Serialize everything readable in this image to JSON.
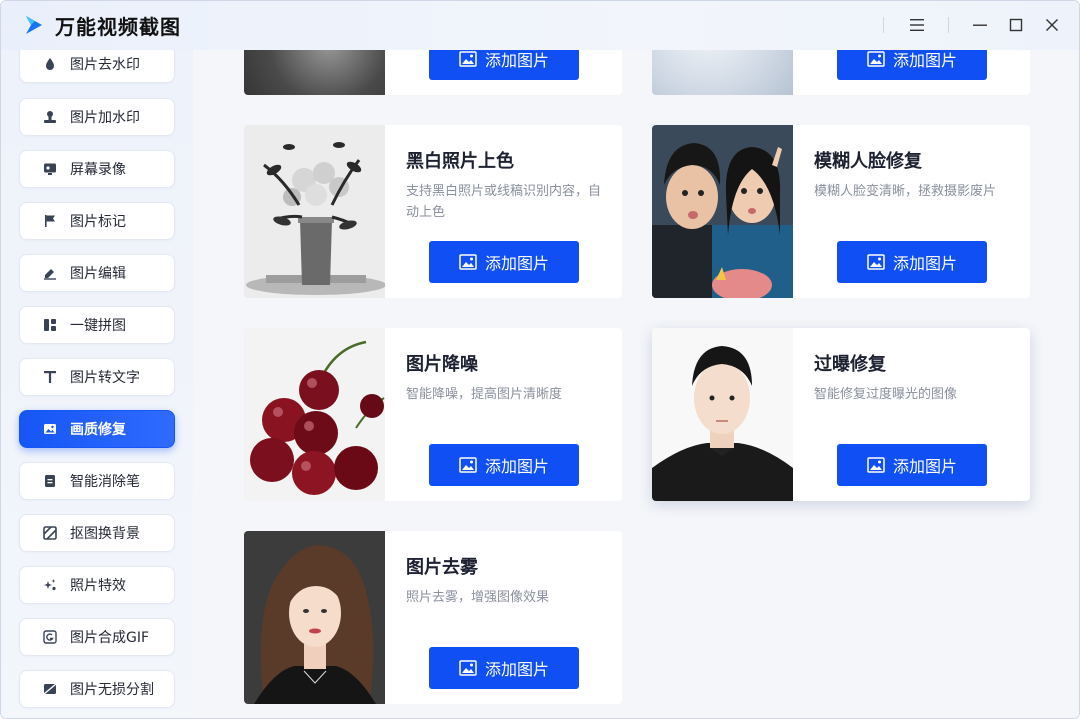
{
  "app": {
    "title": "万能视频截图"
  },
  "window_controls": {
    "menu_icon": "menu-icon",
    "minimize_icon": "minimize-icon",
    "maximize_icon": "maximize-icon",
    "close_icon": "close-icon"
  },
  "colors": {
    "accent": "#0f4ff3",
    "active_item": "#1656f5"
  },
  "sidebar": {
    "items": [
      {
        "label": "图片去水印",
        "icon": "drop-icon",
        "active": false
      },
      {
        "label": "图片加水印",
        "icon": "stamp-icon",
        "active": false
      },
      {
        "label": "屏幕录像",
        "icon": "screen-record-icon",
        "active": false
      },
      {
        "label": "图片标记",
        "icon": "flag-icon",
        "active": false
      },
      {
        "label": "图片编辑",
        "icon": "edit-icon",
        "active": false
      },
      {
        "label": "一键拼图",
        "icon": "grid-icon",
        "active": false
      },
      {
        "label": "图片转文字",
        "icon": "text-icon",
        "active": false
      },
      {
        "label": "画质修复",
        "icon": "image-icon",
        "active": true
      },
      {
        "label": "智能消除笔",
        "icon": "eraser-icon",
        "active": false
      },
      {
        "label": "抠图换背景",
        "icon": "cutout-icon",
        "active": false
      },
      {
        "label": "照片特效",
        "icon": "sparkle-icon",
        "active": false
      },
      {
        "label": "图片合成GIF",
        "icon": "gif-icon",
        "active": false
      },
      {
        "label": "图片无损分割",
        "icon": "split-icon",
        "active": false
      }
    ]
  },
  "cards": [
    {
      "title": "黑白照片上色",
      "desc": "支持黑白照片或线稿识别内容，自动上色",
      "button": "添加图片",
      "thumb": "flower-vase-photo"
    },
    {
      "title": "模糊人脸修复",
      "desc": "模糊人脸变清晰，拯救摄影废片",
      "button": "添加图片",
      "thumb": "couple-photo"
    },
    {
      "title": "图片降噪",
      "desc": "智能降噪，提高图片清晰度",
      "button": "添加图片",
      "thumb": "cherries-photo"
    },
    {
      "title": "过曝修复",
      "desc": "智能修复过度曝光的图像",
      "button": "添加图片",
      "thumb": "man-portrait-photo"
    },
    {
      "title": "图片去雾",
      "desc": "照片去雾，增强图像效果",
      "button": "添加图片",
      "thumb": "woman-portrait-photo"
    }
  ],
  "partial_top_cards": [
    {
      "button": "添加图片"
    },
    {
      "button": "添加图片"
    }
  ]
}
